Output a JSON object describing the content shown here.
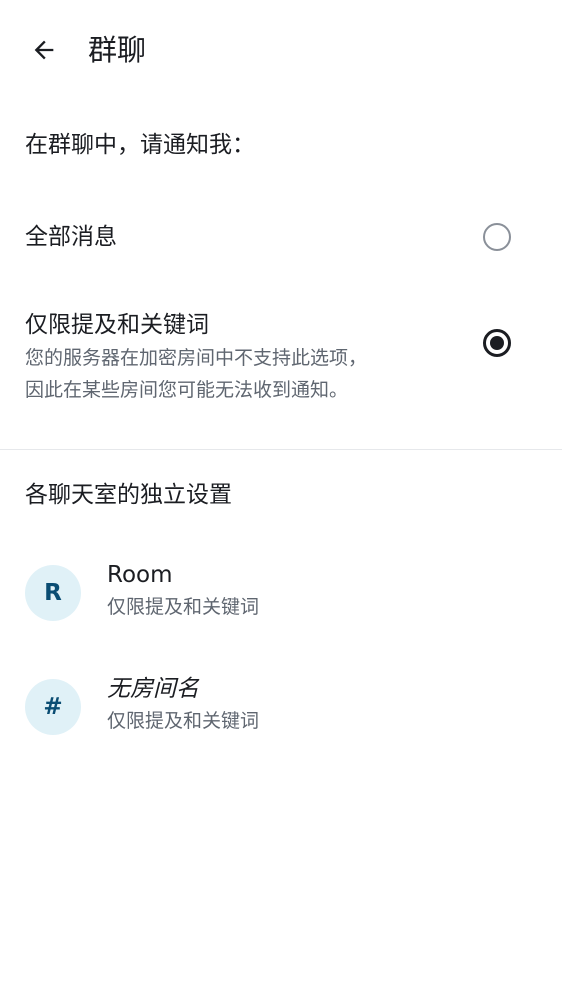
{
  "header": {
    "title": "群聊",
    "back_icon": "arrow-left-icon"
  },
  "notify_section": {
    "heading": "在群聊中，请通知我：",
    "options": [
      {
        "title": "全部消息",
        "selected": false
      },
      {
        "title": "仅限提及和关键词",
        "description_line1": "您的服务器在加密房间中不支持此选项，",
        "description_line2": "因此在某些房间您可能无法收到通知。",
        "selected": true
      }
    ]
  },
  "rooms_section": {
    "heading": "各聊天室的独立设置",
    "rooms": [
      {
        "avatar": "R",
        "name": "Room",
        "setting": "仅限提及和关键词"
      },
      {
        "avatar": "#",
        "name": "无房间名",
        "setting": "仅限提及和关键词"
      }
    ]
  },
  "colors": {
    "text_primary": "#1b1d22",
    "text_secondary": "#5f6670",
    "avatar_bg": "#e0f1f7",
    "avatar_fg": "#0a4d73",
    "divider": "#e6e8eb"
  }
}
